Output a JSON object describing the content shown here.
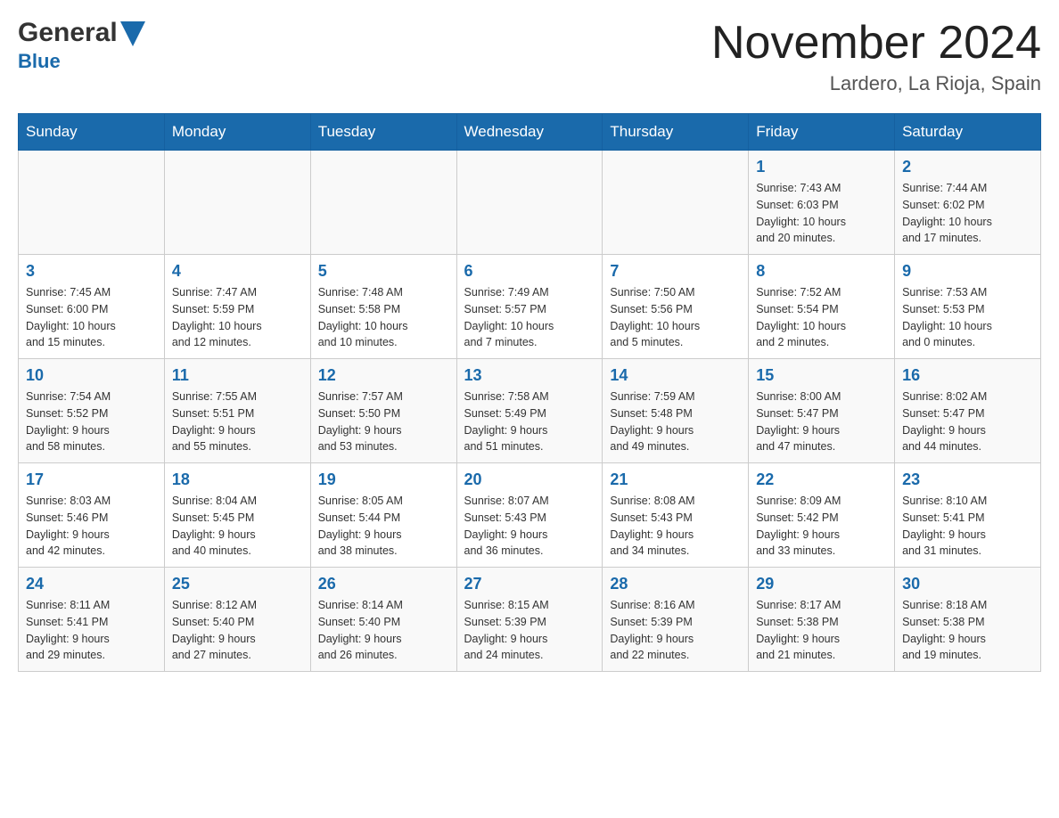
{
  "logo": {
    "general": "General",
    "blue": "Blue"
  },
  "title": "November 2024",
  "subtitle": "Lardero, La Rioja, Spain",
  "days_of_week": [
    "Sunday",
    "Monday",
    "Tuesday",
    "Wednesday",
    "Thursday",
    "Friday",
    "Saturday"
  ],
  "weeks": [
    {
      "cells": [
        {
          "day": "",
          "info": ""
        },
        {
          "day": "",
          "info": ""
        },
        {
          "day": "",
          "info": ""
        },
        {
          "day": "",
          "info": ""
        },
        {
          "day": "",
          "info": ""
        },
        {
          "day": "1",
          "info": "Sunrise: 7:43 AM\nSunset: 6:03 PM\nDaylight: 10 hours\nand 20 minutes."
        },
        {
          "day": "2",
          "info": "Sunrise: 7:44 AM\nSunset: 6:02 PM\nDaylight: 10 hours\nand 17 minutes."
        }
      ]
    },
    {
      "cells": [
        {
          "day": "3",
          "info": "Sunrise: 7:45 AM\nSunset: 6:00 PM\nDaylight: 10 hours\nand 15 minutes."
        },
        {
          "day": "4",
          "info": "Sunrise: 7:47 AM\nSunset: 5:59 PM\nDaylight: 10 hours\nand 12 minutes."
        },
        {
          "day": "5",
          "info": "Sunrise: 7:48 AM\nSunset: 5:58 PM\nDaylight: 10 hours\nand 10 minutes."
        },
        {
          "day": "6",
          "info": "Sunrise: 7:49 AM\nSunset: 5:57 PM\nDaylight: 10 hours\nand 7 minutes."
        },
        {
          "day": "7",
          "info": "Sunrise: 7:50 AM\nSunset: 5:56 PM\nDaylight: 10 hours\nand 5 minutes."
        },
        {
          "day": "8",
          "info": "Sunrise: 7:52 AM\nSunset: 5:54 PM\nDaylight: 10 hours\nand 2 minutes."
        },
        {
          "day": "9",
          "info": "Sunrise: 7:53 AM\nSunset: 5:53 PM\nDaylight: 10 hours\nand 0 minutes."
        }
      ]
    },
    {
      "cells": [
        {
          "day": "10",
          "info": "Sunrise: 7:54 AM\nSunset: 5:52 PM\nDaylight: 9 hours\nand 58 minutes."
        },
        {
          "day": "11",
          "info": "Sunrise: 7:55 AM\nSunset: 5:51 PM\nDaylight: 9 hours\nand 55 minutes."
        },
        {
          "day": "12",
          "info": "Sunrise: 7:57 AM\nSunset: 5:50 PM\nDaylight: 9 hours\nand 53 minutes."
        },
        {
          "day": "13",
          "info": "Sunrise: 7:58 AM\nSunset: 5:49 PM\nDaylight: 9 hours\nand 51 minutes."
        },
        {
          "day": "14",
          "info": "Sunrise: 7:59 AM\nSunset: 5:48 PM\nDaylight: 9 hours\nand 49 minutes."
        },
        {
          "day": "15",
          "info": "Sunrise: 8:00 AM\nSunset: 5:47 PM\nDaylight: 9 hours\nand 47 minutes."
        },
        {
          "day": "16",
          "info": "Sunrise: 8:02 AM\nSunset: 5:47 PM\nDaylight: 9 hours\nand 44 minutes."
        }
      ]
    },
    {
      "cells": [
        {
          "day": "17",
          "info": "Sunrise: 8:03 AM\nSunset: 5:46 PM\nDaylight: 9 hours\nand 42 minutes."
        },
        {
          "day": "18",
          "info": "Sunrise: 8:04 AM\nSunset: 5:45 PM\nDaylight: 9 hours\nand 40 minutes."
        },
        {
          "day": "19",
          "info": "Sunrise: 8:05 AM\nSunset: 5:44 PM\nDaylight: 9 hours\nand 38 minutes."
        },
        {
          "day": "20",
          "info": "Sunrise: 8:07 AM\nSunset: 5:43 PM\nDaylight: 9 hours\nand 36 minutes."
        },
        {
          "day": "21",
          "info": "Sunrise: 8:08 AM\nSunset: 5:43 PM\nDaylight: 9 hours\nand 34 minutes."
        },
        {
          "day": "22",
          "info": "Sunrise: 8:09 AM\nSunset: 5:42 PM\nDaylight: 9 hours\nand 33 minutes."
        },
        {
          "day": "23",
          "info": "Sunrise: 8:10 AM\nSunset: 5:41 PM\nDaylight: 9 hours\nand 31 minutes."
        }
      ]
    },
    {
      "cells": [
        {
          "day": "24",
          "info": "Sunrise: 8:11 AM\nSunset: 5:41 PM\nDaylight: 9 hours\nand 29 minutes."
        },
        {
          "day": "25",
          "info": "Sunrise: 8:12 AM\nSunset: 5:40 PM\nDaylight: 9 hours\nand 27 minutes."
        },
        {
          "day": "26",
          "info": "Sunrise: 8:14 AM\nSunset: 5:40 PM\nDaylight: 9 hours\nand 26 minutes."
        },
        {
          "day": "27",
          "info": "Sunrise: 8:15 AM\nSunset: 5:39 PM\nDaylight: 9 hours\nand 24 minutes."
        },
        {
          "day": "28",
          "info": "Sunrise: 8:16 AM\nSunset: 5:39 PM\nDaylight: 9 hours\nand 22 minutes."
        },
        {
          "day": "29",
          "info": "Sunrise: 8:17 AM\nSunset: 5:38 PM\nDaylight: 9 hours\nand 21 minutes."
        },
        {
          "day": "30",
          "info": "Sunrise: 8:18 AM\nSunset: 5:38 PM\nDaylight: 9 hours\nand 19 minutes."
        }
      ]
    }
  ]
}
